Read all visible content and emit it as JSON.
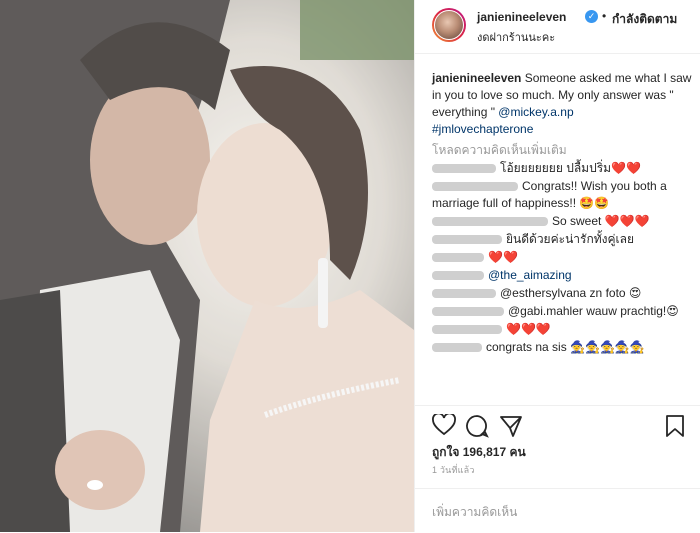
{
  "header": {
    "username": "janienineeleven",
    "dot": "•",
    "follow_label": "กำลังติดตาม",
    "subtitle": "งดฝากร้านนะคะ",
    "verified_mark": "✓"
  },
  "caption": {
    "username": "janienineeleven",
    "text": "Someone asked me what I saw in you to love so much. My only answer was \" everything \" ",
    "mention": "@mickey.a.np",
    "hashtag": "#jmlovechapterone"
  },
  "load_more": "โหลดความคิดเห็นเพิ่มเติม",
  "comments": [
    {
      "text": "โอ้ยยยยยยย ปลื้มปริ่ม",
      "emoji": "❤️❤️"
    },
    {
      "text": "Congrats!! Wish you both a marriage full of happiness!!",
      "emoji": "🤩🤩"
    },
    {
      "text": "So sweet",
      "emoji": "❤️❤️❤️"
    },
    {
      "text": "ยินดีด้วยค่ะน่ารักทั้งคู่เลย",
      "emoji": ""
    },
    {
      "text": "",
      "emoji": "❤️❤️"
    },
    {
      "text": "@the_aimazing",
      "emoji": ""
    },
    {
      "text": "@esthersylvana zn foto",
      "emoji": "😍"
    },
    {
      "text": "@gabi.mahler wauw prachtig!",
      "emoji": "😍"
    },
    {
      "text": "",
      "emoji": "❤️❤️❤️"
    },
    {
      "text": "congrats na sis",
      "emoji": "🧙🧙🧙🧙🧙"
    }
  ],
  "likes": {
    "label": "ถูกใจ 196,817 คน"
  },
  "timestamp": "1 วันที่แล้ว",
  "add_comment_placeholder": "เพิ่มความคิดเห็น",
  "icons": [
    "heart-icon",
    "comment-icon",
    "share-icon",
    "bookmark-icon"
  ]
}
